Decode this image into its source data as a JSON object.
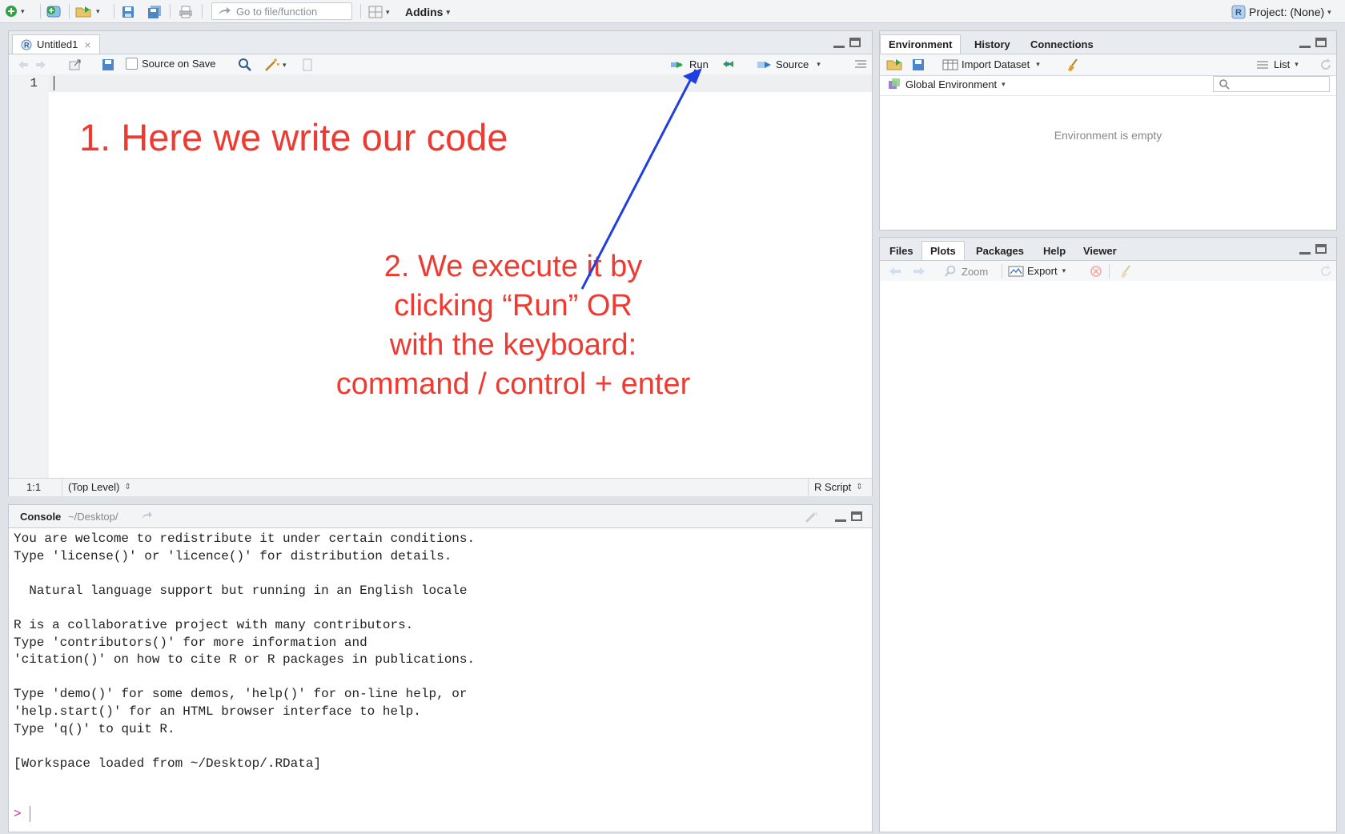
{
  "topbar": {
    "goto_placeholder": "Go to file/function",
    "addins_label": "Addins",
    "project_label": "Project: (None)"
  },
  "editor": {
    "tab_label": "Untitled1",
    "source_on_save_label": "Source on Save",
    "run_label": "Run",
    "source_label": "Source",
    "line_number": "1",
    "position": "1:1",
    "scope": "(Top Level)",
    "file_type": "R Script"
  },
  "annotations": {
    "note1": "1. Here we write our code",
    "note2_lines": [
      "2. We execute it by",
      "clicking “Run” OR",
      "with the keyboard:",
      "command / control + enter"
    ],
    "arrow_color": "#1f3fe0"
  },
  "console": {
    "tab_label": "Console",
    "path": "~/Desktop/",
    "lines": [
      "You are welcome to redistribute it under certain conditions.",
      "Type 'license()' or 'licence()' for distribution details.",
      "",
      "  Natural language support but running in an English locale",
      "",
      "R is a collaborative project with many contributors.",
      "Type 'contributors()' for more information and",
      "'citation()' on how to cite R or R packages in publications.",
      "",
      "Type 'demo()' for some demos, 'help()' for on-line help, or",
      "'help.start()' for an HTML browser interface to help.",
      "Type 'q()' to quit R.",
      "",
      "[Workspace loaded from ~/Desktop/.RData]"
    ],
    "prompt": ">"
  },
  "env_panel": {
    "tabs": [
      "Environment",
      "History",
      "Connections"
    ],
    "import_label": "Import Dataset",
    "list_label": "List",
    "global_env_label": "Global Environment",
    "empty_message": "Environment is empty"
  },
  "files_panel": {
    "tabs": [
      "Files",
      "Plots",
      "Packages",
      "Help",
      "Viewer"
    ],
    "zoom_label": "Zoom",
    "export_label": "Export"
  },
  "colors": {
    "accent_red": "#ef3a32",
    "prompt": "#b03aa4"
  }
}
